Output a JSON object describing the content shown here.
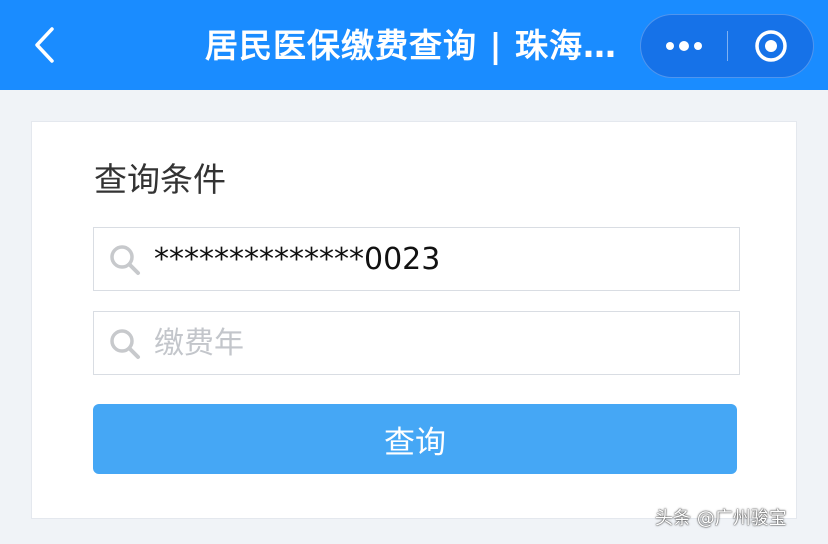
{
  "header": {
    "title": "居民医保缴费查询 | 珠海…",
    "back_icon": "chevron-left-icon",
    "more_icon": "more-dots-icon",
    "close_icon": "target-close-icon",
    "color": "#1a8cff"
  },
  "form": {
    "section_title": "查询条件",
    "id_field": {
      "value": "**************0023",
      "placeholder": ""
    },
    "year_field": {
      "value": "",
      "placeholder": "缴费年"
    },
    "search_icon": "search-icon",
    "submit_label": "查询",
    "button_color": "#45a7f5"
  },
  "watermark": "头条 @广州骏宝"
}
